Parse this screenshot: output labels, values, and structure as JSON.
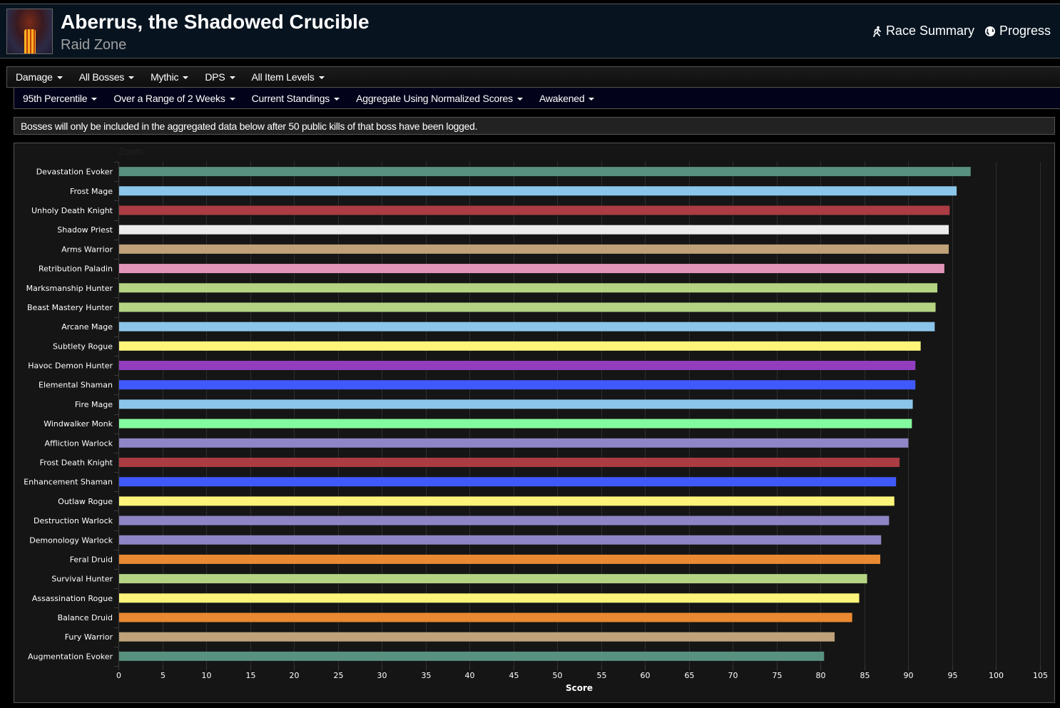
{
  "header": {
    "title": "Aberrus, the Shadowed Crucible",
    "subtitle": "Raid Zone",
    "zone_icon": "raid-zone-image",
    "links": [
      {
        "label": "Race Summary",
        "icon": "running-person-icon"
      },
      {
        "label": "Progress",
        "icon": "globe-icon"
      }
    ]
  },
  "filters_row1": [
    "Damage",
    "All Bosses",
    "Mythic",
    "DPS",
    "All Item Levels"
  ],
  "filters_row2": [
    "95th Percentile",
    "Over a Range of 2 Weeks",
    "Current Standings",
    "Aggregate Using Normalized Scores",
    "Awakened"
  ],
  "notice": "Bosses will only be included in the aggregated data below after 50 public kills of that boss have been logged.",
  "chart_data": {
    "type": "bar",
    "orientation": "horizontal",
    "zoom_label": "Zoom",
    "title": "",
    "xlabel": "Score",
    "ylabel": "",
    "xlim": [
      0,
      105
    ],
    "xticks": [
      0,
      5,
      10,
      15,
      20,
      25,
      30,
      35,
      40,
      45,
      50,
      55,
      60,
      65,
      70,
      75,
      80,
      85,
      90,
      95,
      100,
      105
    ],
    "grid": true,
    "legend": "none",
    "categories": [
      "Devastation Evoker",
      "Frost Mage",
      "Unholy Death Knight",
      "Shadow Priest",
      "Arms Warrior",
      "Retribution Paladin",
      "Marksmanship Hunter",
      "Beast Mastery Hunter",
      "Arcane Mage",
      "Subtlety Rogue",
      "Havoc Demon Hunter",
      "Elemental Shaman",
      "Fire Mage",
      "Windwalker Monk",
      "Affliction Warlock",
      "Frost Death Knight",
      "Enhancement Shaman",
      "Outlaw Rogue",
      "Destruction Warlock",
      "Demonology Warlock",
      "Feral Druid",
      "Survival Hunter",
      "Assassination Rogue",
      "Balance Druid",
      "Fury Warrior",
      "Augmentation Evoker"
    ],
    "values": [
      97.1,
      95.5,
      94.7,
      94.6,
      94.6,
      94.1,
      93.3,
      93.1,
      93.0,
      91.4,
      90.8,
      90.8,
      90.5,
      90.4,
      90.0,
      89.0,
      88.6,
      88.4,
      87.8,
      86.9,
      86.8,
      85.3,
      84.4,
      83.6,
      81.6,
      80.4
    ],
    "colors": [
      "#58917f",
      "#8bc6ea",
      "#ab3c43",
      "#ececec",
      "#bfa27a",
      "#e294b9",
      "#b5d483",
      "#b5d483",
      "#8bc6ea",
      "#fdf57a",
      "#933ebf",
      "#3f59fa",
      "#8bc6ea",
      "#84fa9f",
      "#8e85c6",
      "#ab3c43",
      "#3f59fa",
      "#fdf57a",
      "#8e85c6",
      "#8e85c6",
      "#e98932",
      "#b5d483",
      "#fdf57a",
      "#e98932",
      "#bfa27a",
      "#58917f"
    ]
  }
}
